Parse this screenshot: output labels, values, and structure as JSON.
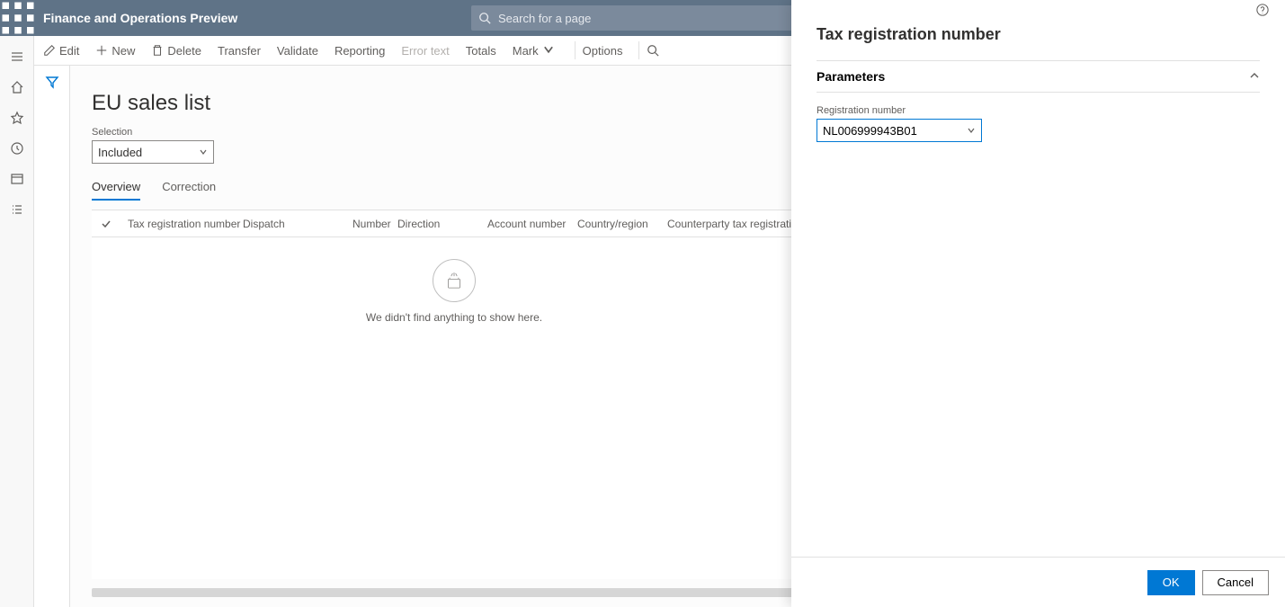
{
  "app": {
    "title": "Finance and Operations Preview"
  },
  "search": {
    "placeholder": "Search for a page"
  },
  "actions": {
    "edit": "Edit",
    "new": "New",
    "delete": "Delete",
    "transfer": "Transfer",
    "validate": "Validate",
    "reporting": "Reporting",
    "error_text": "Error text",
    "totals": "Totals",
    "mark": "Mark",
    "options": "Options"
  },
  "page": {
    "title": "EU sales list",
    "selection_label": "Selection",
    "selection_value": "Included"
  },
  "tabs": {
    "overview": "Overview",
    "correction": "Correction"
  },
  "columns": {
    "tax_reg": "Tax registration number",
    "dispatch": "Dispatch",
    "number": "Number",
    "direction": "Direction",
    "account": "Account number",
    "country": "Country/region",
    "counterparty": "Counterparty tax registration"
  },
  "empty": {
    "message": "We didn't find anything to show here."
  },
  "sidepanel": {
    "title": "Tax registration number",
    "section": "Parameters",
    "field_label": "Registration number",
    "field_value": "NL006999943B01",
    "ok": "OK",
    "cancel": "Cancel"
  }
}
